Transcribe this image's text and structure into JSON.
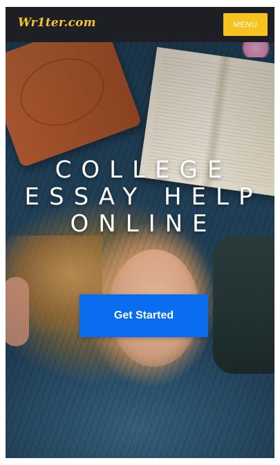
{
  "header": {
    "logo_text": "Wr1ter.com",
    "menu_label": "MENU"
  },
  "hero": {
    "title_line1": "COLLEGE",
    "title_line2": "ESSAY HELP",
    "title_line3": "ONLINE",
    "cta_label": "Get Started"
  },
  "colors": {
    "navbar_bg": "#1e1f24",
    "logo": "#f4c430",
    "menu_button": "#f6c31f",
    "cta_button": "#0a6df0"
  }
}
